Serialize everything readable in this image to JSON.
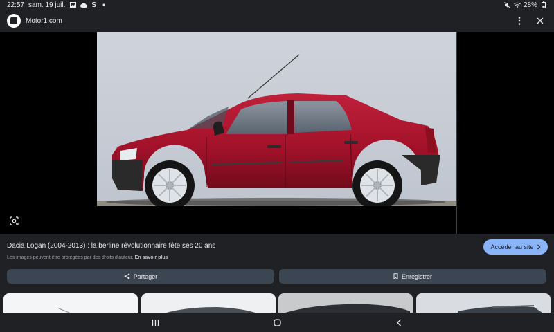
{
  "status_bar": {
    "time": "22:57",
    "date": "sam. 19 juil.",
    "extra_icon": "S",
    "battery": "28%"
  },
  "header": {
    "site_name": "Motor1.com",
    "icons": [
      "site-logo",
      "more-vert-icon",
      "close-icon"
    ]
  },
  "result": {
    "title": "Dacia Logan (2004-2013) : la berline révolutionnaire fête ses 20 ans",
    "visit_label": "Accéder au site",
    "copyright_notice": "Les images peuvent être protégées par des droits d'auteur.",
    "learn_more": "En savoir plus",
    "share_label": "Partager",
    "save_label": "Enregistrer"
  },
  "colors": {
    "surface": "#202124",
    "accent": "#8ab4f8",
    "button_bg": "#3c4552",
    "car_body": "#a3122a"
  }
}
